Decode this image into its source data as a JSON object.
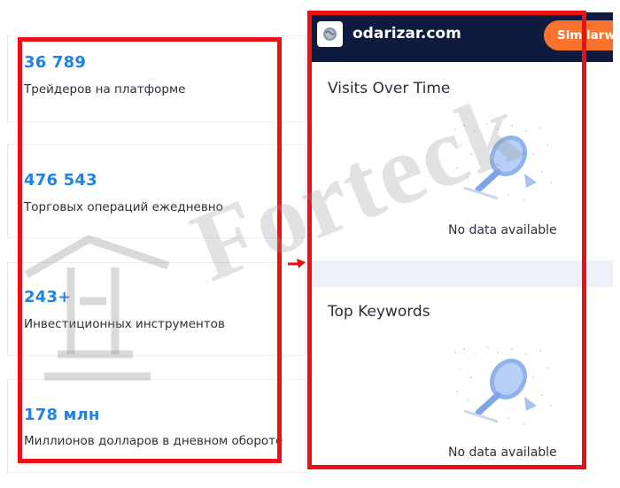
{
  "stats": [
    {
      "value": "36 789",
      "label": "Трейдеров на платформе"
    },
    {
      "value": "476 543",
      "label": "Торговых операций ежедневно"
    },
    {
      "value": "243+",
      "label": "Инвестиционных инструментов"
    },
    {
      "value": "178 млн",
      "label": "Миллионов долларов в дневном обороте"
    }
  ],
  "widget": {
    "site_name": "odarizar.com",
    "button_label": "Similarweb",
    "sections": [
      {
        "title": "Visits Over Time",
        "empty_text": "No data available"
      },
      {
        "title": "Top Keywords",
        "empty_text": "No data available"
      }
    ]
  },
  "watermark": {
    "text": "Forteck"
  },
  "colors": {
    "accent_blue": "#1e83e6",
    "highlight_red": "#ee0e16",
    "header_navy": "#0f1b3e",
    "button_orange": "#f7732e"
  },
  "icons": [
    "globe-icon",
    "magnifier-illustration",
    "arrow-icon",
    "tower-logo"
  ]
}
